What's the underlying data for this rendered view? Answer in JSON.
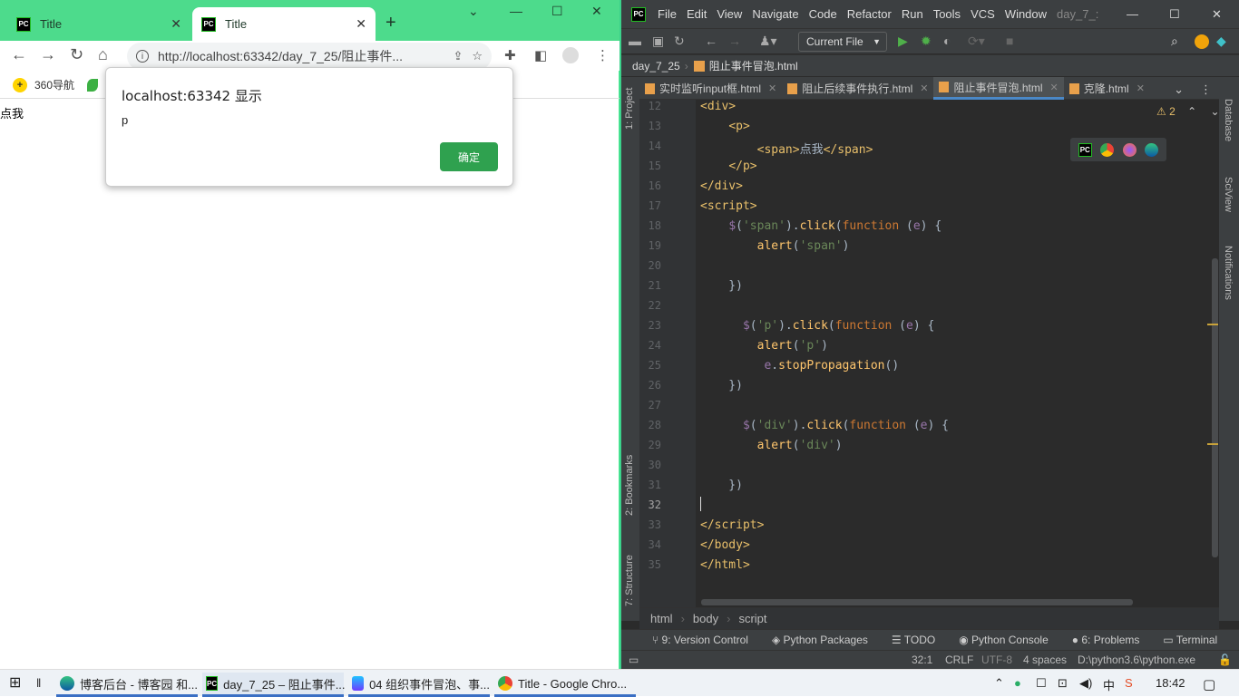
{
  "browser": {
    "tabs": [
      {
        "title": "Title",
        "active": false
      },
      {
        "title": "Title",
        "active": true
      }
    ],
    "url": "http://localhost:63342/day_7_25/阻止事件...",
    "bookmarks": [
      {
        "label": "360导航"
      }
    ],
    "page_text": "点我",
    "dialog": {
      "title": "localhost:63342 显示",
      "message": "p",
      "ok_label": "确定"
    },
    "accent": "#4ddb8c"
  },
  "ide": {
    "menu": [
      "File",
      "Edit",
      "View",
      "Navigate",
      "Code",
      "Refactor",
      "Run",
      "Tools",
      "VCS",
      "Window",
      "day_7_:"
    ],
    "run_config": "Current File",
    "nav_project": "day_7_25",
    "nav_file": "阻止事件冒泡.html",
    "editor_tabs": [
      {
        "label": "实时监听input框.html",
        "active": false
      },
      {
        "label": "阻止后续事件执行.html",
        "active": false
      },
      {
        "label": "阻止事件冒泡.html",
        "active": true
      },
      {
        "label": "克隆.html",
        "active": false
      }
    ],
    "warning_count": "2",
    "line_numbers": [
      "12",
      "13",
      "14",
      "15",
      "16",
      "17",
      "18",
      "19",
      "20",
      "21",
      "22",
      "23",
      "24",
      "25",
      "26",
      "27",
      "28",
      "29",
      "30",
      "31",
      "32",
      "33",
      "34",
      "35"
    ],
    "left_tools": [
      "1: Project",
      "2: Bookmarks",
      "7: Structure"
    ],
    "right_tools": [
      "Database",
      "SciView",
      "Notifications"
    ],
    "breadcrumb": [
      "html",
      "body",
      "script"
    ],
    "tool_windows": [
      "9: Version Control",
      "Python Packages",
      "TODO",
      "Python Console",
      "6: Problems",
      "Terminal"
    ],
    "status": {
      "position": "32:1",
      "line_sep": "CRLF",
      "encoding": "UTF-8",
      "indent": "4 spaces",
      "interpreter": "D:\\python3.6\\python.exe"
    }
  },
  "taskbar": {
    "items": [
      {
        "label": "博客后台 - 博客园 和..."
      },
      {
        "label": "day_7_25 – 阻止事件..."
      },
      {
        "label": "04 组织事件冒泡、事..."
      },
      {
        "label": "Title - Google Chro..."
      }
    ],
    "time": "18:42"
  }
}
